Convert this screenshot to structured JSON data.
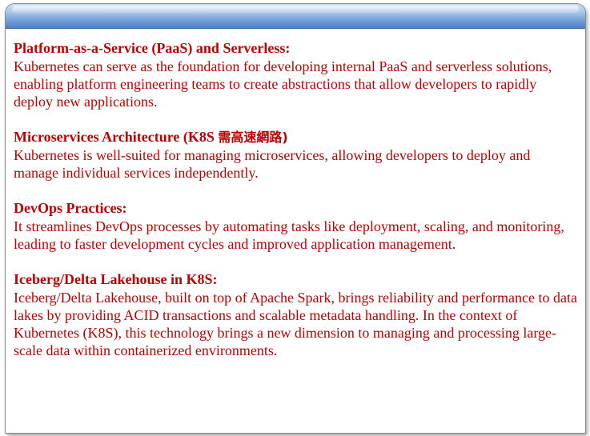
{
  "sections": [
    {
      "title": "Platform-as-a-Service (PaaS) and Serverless:",
      "title_extra": "",
      "body": "Kubernetes can serve as the foundation for developing internal PaaS and serverless solutions, enabling platform engineering teams to create abstractions that allow developers to rapidly deploy new applications."
    },
    {
      "title": "Microservices Architecture (K8S ",
      "title_extra": "需高速網路)",
      "body": "Kubernetes is well-suited for managing microservices, allowing developers to deploy and manage individual services independently."
    },
    {
      "title": "DevOps Practices:",
      "title_extra": "",
      "body": "It streamlines DevOps processes by automating tasks like deployment, scaling, and monitoring, leading to faster development cycles and improved application management."
    },
    {
      "title": "Iceberg/Delta Lakehouse in K8S:",
      "title_extra": "",
      "body": "Iceberg/Delta Lakehouse, built on top of Apache Spark, brings reliability and performance to data lakes by providing ACID transactions and scalable metadata handling. In the context of Kubernetes (K8S), this technology brings a new dimension to managing and processing large-scale data within containerized environments."
    }
  ],
  "colors": {
    "text": "#c00000",
    "header_bar": "#7fa8dc"
  }
}
